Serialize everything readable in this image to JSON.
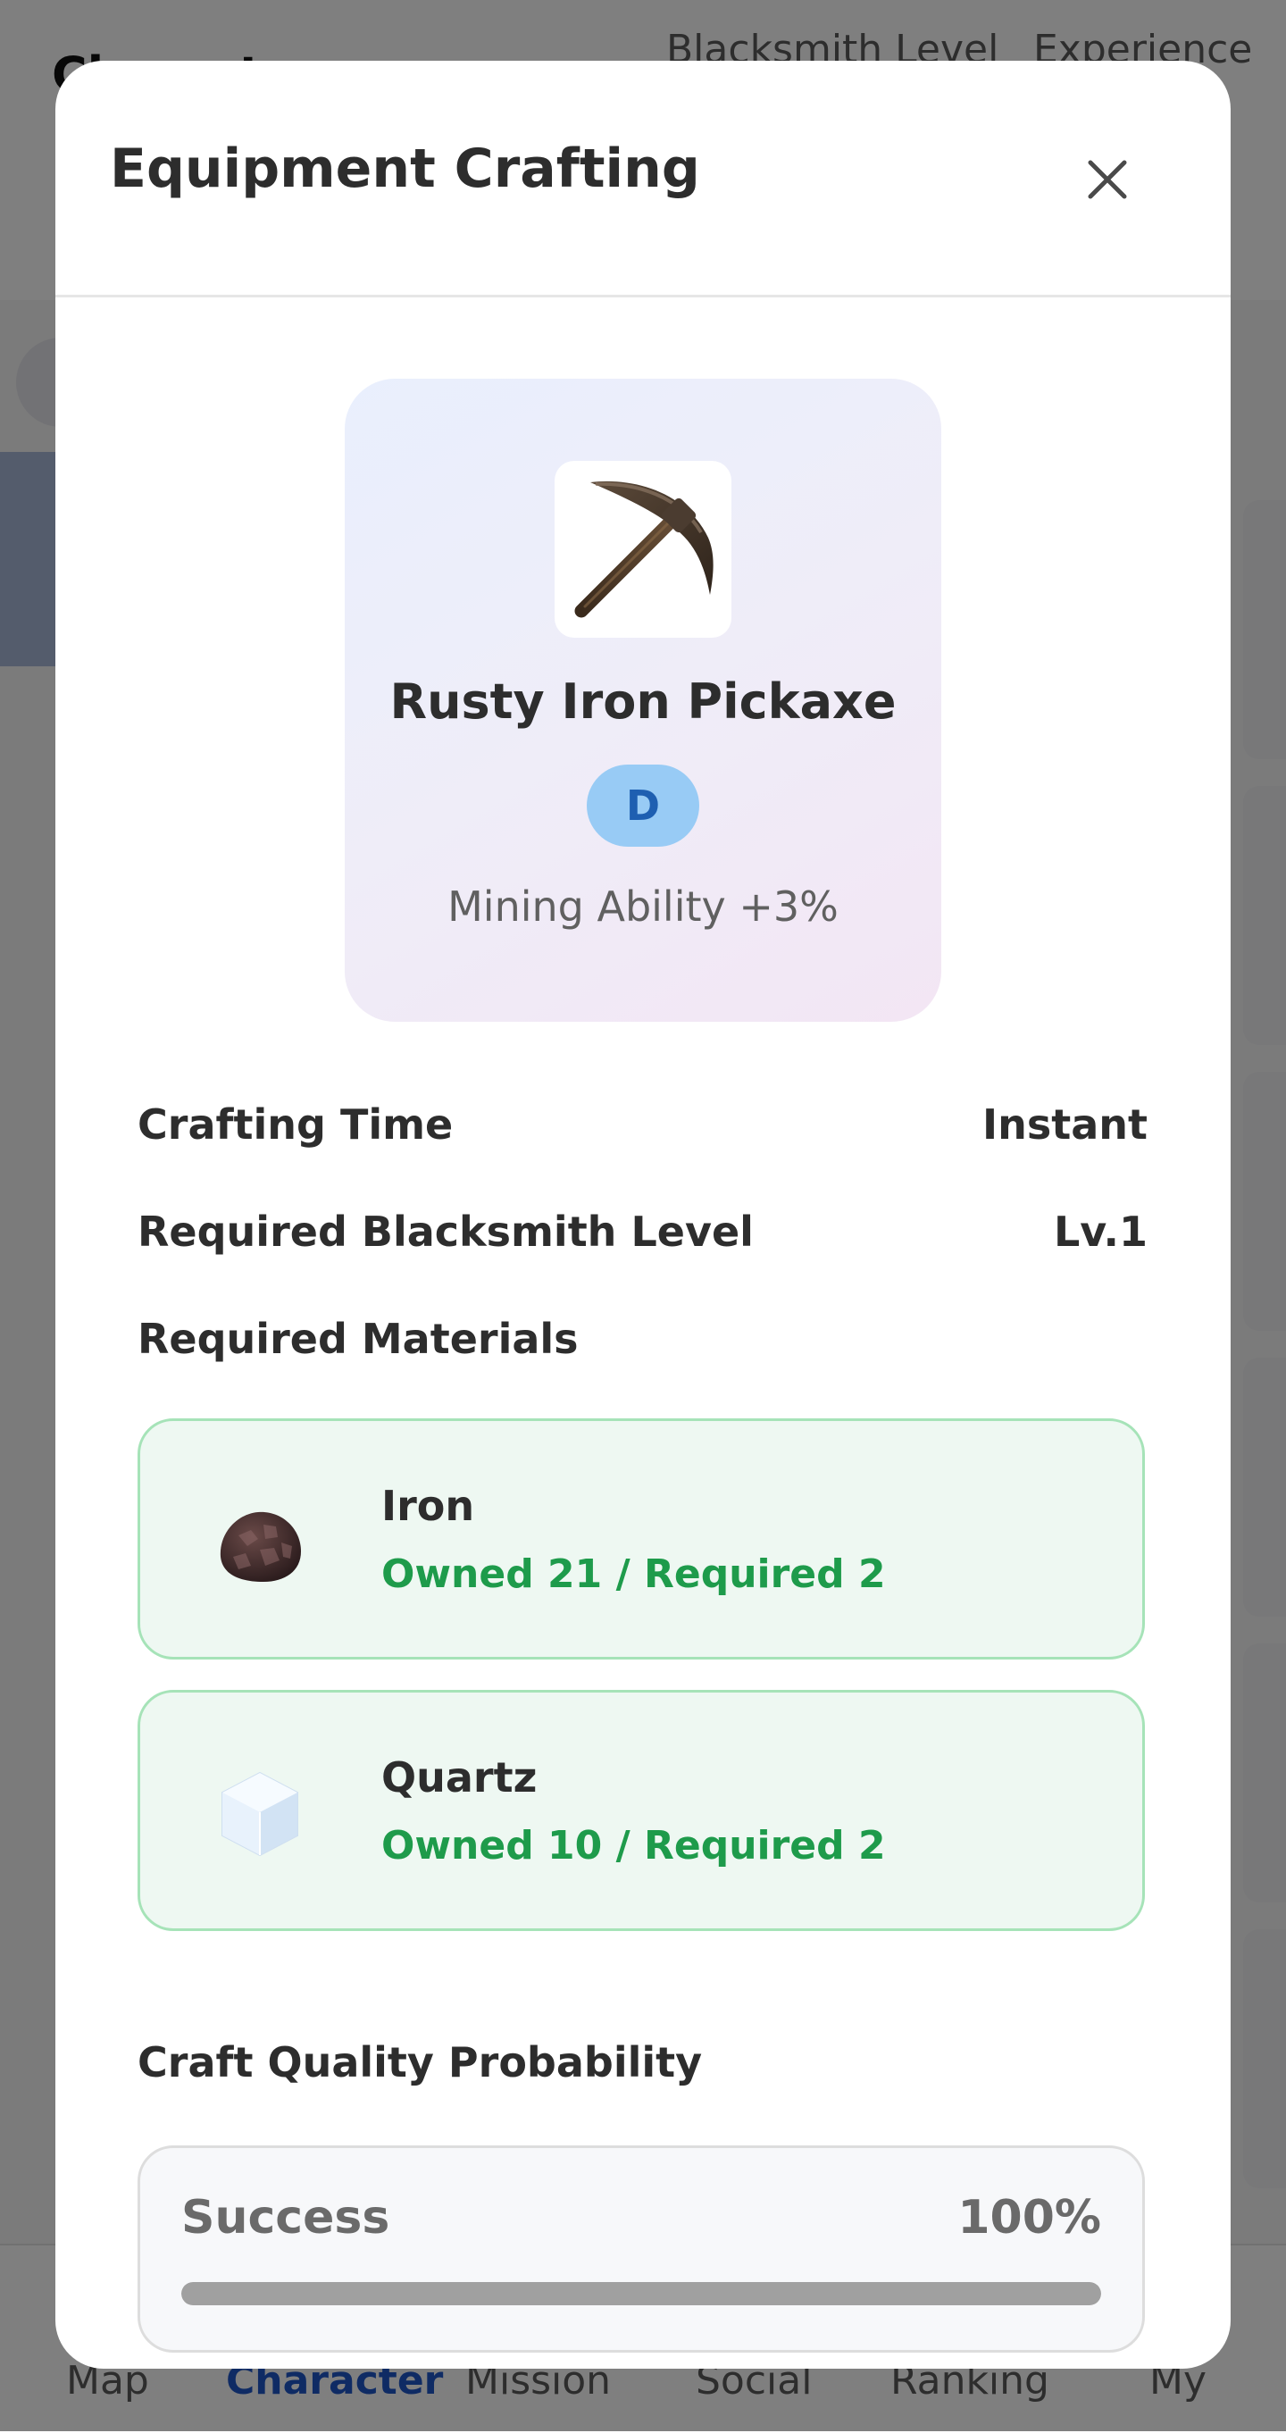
{
  "background": {
    "page_title": "Character",
    "stats": {
      "blacksmith_level_label": "Blacksmith Level",
      "experience_label": "Experience"
    },
    "bottom_nav": {
      "items": [
        {
          "label": "Map"
        },
        {
          "label": "Character",
          "active": true
        },
        {
          "label": "Mission"
        },
        {
          "label": "Social"
        },
        {
          "label": "Ranking"
        },
        {
          "label": "My"
        }
      ]
    }
  },
  "modal": {
    "title": "Equipment Crafting",
    "close_icon": "close-icon",
    "item": {
      "icon": "pickaxe-icon",
      "name": "Rusty Iron Pickaxe",
      "grade": "D",
      "stat": "Mining Ability +3%"
    },
    "info": {
      "crafting_time_label": "Crafting Time",
      "crafting_time_value": "Instant",
      "required_level_label": "Required Blacksmith Level",
      "required_level_value": "Lv.1",
      "materials_label": "Required Materials"
    },
    "materials": [
      {
        "icon": "iron-ore-icon",
        "name": "Iron",
        "count": "Owned 21 / Required 2"
      },
      {
        "icon": "quartz-icon",
        "name": "Quartz",
        "count": "Owned 10 / Required 2"
      }
    ],
    "probability": {
      "section_label": "Craft Quality Probability",
      "rows": [
        {
          "label": "Success",
          "value": "100%",
          "fraction": 1.0
        }
      ]
    }
  },
  "colors": {
    "accent_blue": "#1f57c8",
    "success_green": "#1e9b4b",
    "material_border": "#a6e3b8",
    "grade_badge_bg": "#98cbf5"
  }
}
